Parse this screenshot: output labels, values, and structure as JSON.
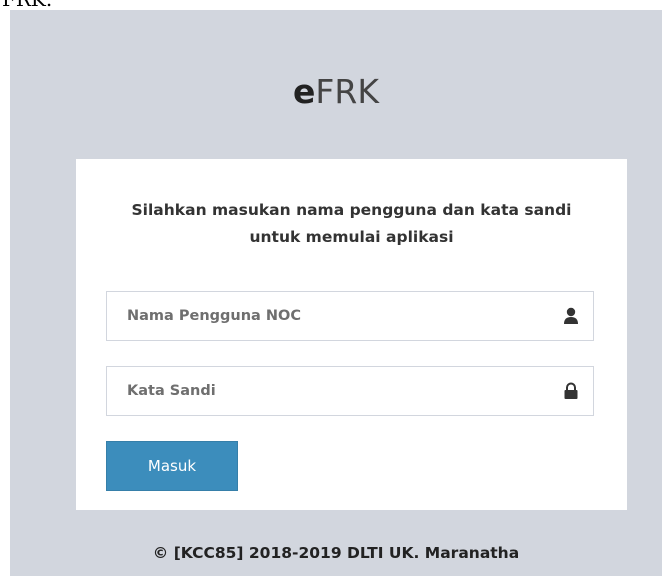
{
  "top_text": "FRK.",
  "logo": {
    "bold": "e",
    "rest": "FRK"
  },
  "login": {
    "message": "Silahkan masukan nama pengguna dan kata sandi untuk memulai aplikasi",
    "username_placeholder": "Nama Pengguna NOC",
    "password_placeholder": "Kata Sandi",
    "username_icon": "user-icon",
    "password_icon": "lock-icon",
    "submit_label": "Masuk"
  },
  "footer": "© [KCC85] 2018-2019 DLTI UK. Maranatha",
  "colors": {
    "background": "#d2d6de",
    "card": "#ffffff",
    "button": "#3c8dbc"
  }
}
